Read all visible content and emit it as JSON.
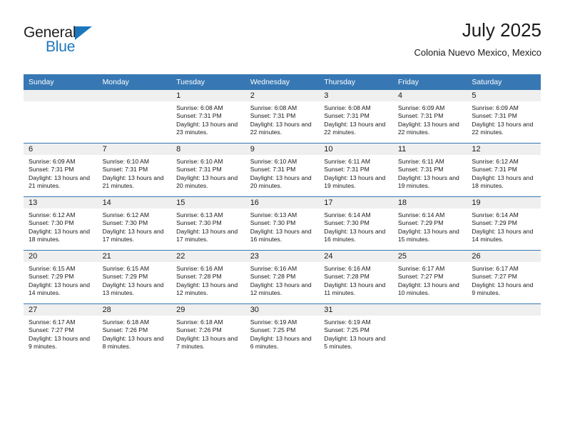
{
  "branding": {
    "logo_text_primary": "General",
    "logo_text_secondary": "Blue",
    "logo_primary_color": "#231f20",
    "logo_accent_color": "#1c76bc"
  },
  "header": {
    "month_title": "July 2025",
    "location": "Colonia Nuevo Mexico, Mexico"
  },
  "theme": {
    "header_background": "#3778b4",
    "header_text": "#ffffff",
    "daynum_band_background": "#efefef",
    "row_divider": "#3778b4",
    "body_text": "#1a1a1a"
  },
  "weekday_headers": [
    "Sunday",
    "Monday",
    "Tuesday",
    "Wednesday",
    "Thursday",
    "Friday",
    "Saturday"
  ],
  "weeks": [
    [
      {
        "day": "",
        "empty": true,
        "sunrise": "",
        "sunset": "",
        "daylight": ""
      },
      {
        "day": "",
        "empty": true,
        "sunrise": "",
        "sunset": "",
        "daylight": ""
      },
      {
        "day": "1",
        "empty": false,
        "sunrise": "Sunrise: 6:08 AM",
        "sunset": "Sunset: 7:31 PM",
        "daylight": "Daylight: 13 hours and 23 minutes."
      },
      {
        "day": "2",
        "empty": false,
        "sunrise": "Sunrise: 6:08 AM",
        "sunset": "Sunset: 7:31 PM",
        "daylight": "Daylight: 13 hours and 22 minutes."
      },
      {
        "day": "3",
        "empty": false,
        "sunrise": "Sunrise: 6:08 AM",
        "sunset": "Sunset: 7:31 PM",
        "daylight": "Daylight: 13 hours and 22 minutes."
      },
      {
        "day": "4",
        "empty": false,
        "sunrise": "Sunrise: 6:09 AM",
        "sunset": "Sunset: 7:31 PM",
        "daylight": "Daylight: 13 hours and 22 minutes."
      },
      {
        "day": "5",
        "empty": false,
        "sunrise": "Sunrise: 6:09 AM",
        "sunset": "Sunset: 7:31 PM",
        "daylight": "Daylight: 13 hours and 22 minutes."
      }
    ],
    [
      {
        "day": "6",
        "empty": false,
        "sunrise": "Sunrise: 6:09 AM",
        "sunset": "Sunset: 7:31 PM",
        "daylight": "Daylight: 13 hours and 21 minutes."
      },
      {
        "day": "7",
        "empty": false,
        "sunrise": "Sunrise: 6:10 AM",
        "sunset": "Sunset: 7:31 PM",
        "daylight": "Daylight: 13 hours and 21 minutes."
      },
      {
        "day": "8",
        "empty": false,
        "sunrise": "Sunrise: 6:10 AM",
        "sunset": "Sunset: 7:31 PM",
        "daylight": "Daylight: 13 hours and 20 minutes."
      },
      {
        "day": "9",
        "empty": false,
        "sunrise": "Sunrise: 6:10 AM",
        "sunset": "Sunset: 7:31 PM",
        "daylight": "Daylight: 13 hours and 20 minutes."
      },
      {
        "day": "10",
        "empty": false,
        "sunrise": "Sunrise: 6:11 AM",
        "sunset": "Sunset: 7:31 PM",
        "daylight": "Daylight: 13 hours and 19 minutes."
      },
      {
        "day": "11",
        "empty": false,
        "sunrise": "Sunrise: 6:11 AM",
        "sunset": "Sunset: 7:31 PM",
        "daylight": "Daylight: 13 hours and 19 minutes."
      },
      {
        "day": "12",
        "empty": false,
        "sunrise": "Sunrise: 6:12 AM",
        "sunset": "Sunset: 7:31 PM",
        "daylight": "Daylight: 13 hours and 18 minutes."
      }
    ],
    [
      {
        "day": "13",
        "empty": false,
        "sunrise": "Sunrise: 6:12 AM",
        "sunset": "Sunset: 7:30 PM",
        "daylight": "Daylight: 13 hours and 18 minutes."
      },
      {
        "day": "14",
        "empty": false,
        "sunrise": "Sunrise: 6:12 AM",
        "sunset": "Sunset: 7:30 PM",
        "daylight": "Daylight: 13 hours and 17 minutes."
      },
      {
        "day": "15",
        "empty": false,
        "sunrise": "Sunrise: 6:13 AM",
        "sunset": "Sunset: 7:30 PM",
        "daylight": "Daylight: 13 hours and 17 minutes."
      },
      {
        "day": "16",
        "empty": false,
        "sunrise": "Sunrise: 6:13 AM",
        "sunset": "Sunset: 7:30 PM",
        "daylight": "Daylight: 13 hours and 16 minutes."
      },
      {
        "day": "17",
        "empty": false,
        "sunrise": "Sunrise: 6:14 AM",
        "sunset": "Sunset: 7:30 PM",
        "daylight": "Daylight: 13 hours and 16 minutes."
      },
      {
        "day": "18",
        "empty": false,
        "sunrise": "Sunrise: 6:14 AM",
        "sunset": "Sunset: 7:29 PM",
        "daylight": "Daylight: 13 hours and 15 minutes."
      },
      {
        "day": "19",
        "empty": false,
        "sunrise": "Sunrise: 6:14 AM",
        "sunset": "Sunset: 7:29 PM",
        "daylight": "Daylight: 13 hours and 14 minutes."
      }
    ],
    [
      {
        "day": "20",
        "empty": false,
        "sunrise": "Sunrise: 6:15 AM",
        "sunset": "Sunset: 7:29 PM",
        "daylight": "Daylight: 13 hours and 14 minutes."
      },
      {
        "day": "21",
        "empty": false,
        "sunrise": "Sunrise: 6:15 AM",
        "sunset": "Sunset: 7:29 PM",
        "daylight": "Daylight: 13 hours and 13 minutes."
      },
      {
        "day": "22",
        "empty": false,
        "sunrise": "Sunrise: 6:16 AM",
        "sunset": "Sunset: 7:28 PM",
        "daylight": "Daylight: 13 hours and 12 minutes."
      },
      {
        "day": "23",
        "empty": false,
        "sunrise": "Sunrise: 6:16 AM",
        "sunset": "Sunset: 7:28 PM",
        "daylight": "Daylight: 13 hours and 12 minutes."
      },
      {
        "day": "24",
        "empty": false,
        "sunrise": "Sunrise: 6:16 AM",
        "sunset": "Sunset: 7:28 PM",
        "daylight": "Daylight: 13 hours and 11 minutes."
      },
      {
        "day": "25",
        "empty": false,
        "sunrise": "Sunrise: 6:17 AM",
        "sunset": "Sunset: 7:27 PM",
        "daylight": "Daylight: 13 hours and 10 minutes."
      },
      {
        "day": "26",
        "empty": false,
        "sunrise": "Sunrise: 6:17 AM",
        "sunset": "Sunset: 7:27 PM",
        "daylight": "Daylight: 13 hours and 9 minutes."
      }
    ],
    [
      {
        "day": "27",
        "empty": false,
        "sunrise": "Sunrise: 6:17 AM",
        "sunset": "Sunset: 7:27 PM",
        "daylight": "Daylight: 13 hours and 9 minutes."
      },
      {
        "day": "28",
        "empty": false,
        "sunrise": "Sunrise: 6:18 AM",
        "sunset": "Sunset: 7:26 PM",
        "daylight": "Daylight: 13 hours and 8 minutes."
      },
      {
        "day": "29",
        "empty": false,
        "sunrise": "Sunrise: 6:18 AM",
        "sunset": "Sunset: 7:26 PM",
        "daylight": "Daylight: 13 hours and 7 minutes."
      },
      {
        "day": "30",
        "empty": false,
        "sunrise": "Sunrise: 6:19 AM",
        "sunset": "Sunset: 7:25 PM",
        "daylight": "Daylight: 13 hours and 6 minutes."
      },
      {
        "day": "31",
        "empty": false,
        "sunrise": "Sunrise: 6:19 AM",
        "sunset": "Sunset: 7:25 PM",
        "daylight": "Daylight: 13 hours and 5 minutes."
      },
      {
        "day": "",
        "empty": true,
        "sunrise": "",
        "sunset": "",
        "daylight": ""
      },
      {
        "day": "",
        "empty": true,
        "sunrise": "",
        "sunset": "",
        "daylight": ""
      }
    ]
  ]
}
